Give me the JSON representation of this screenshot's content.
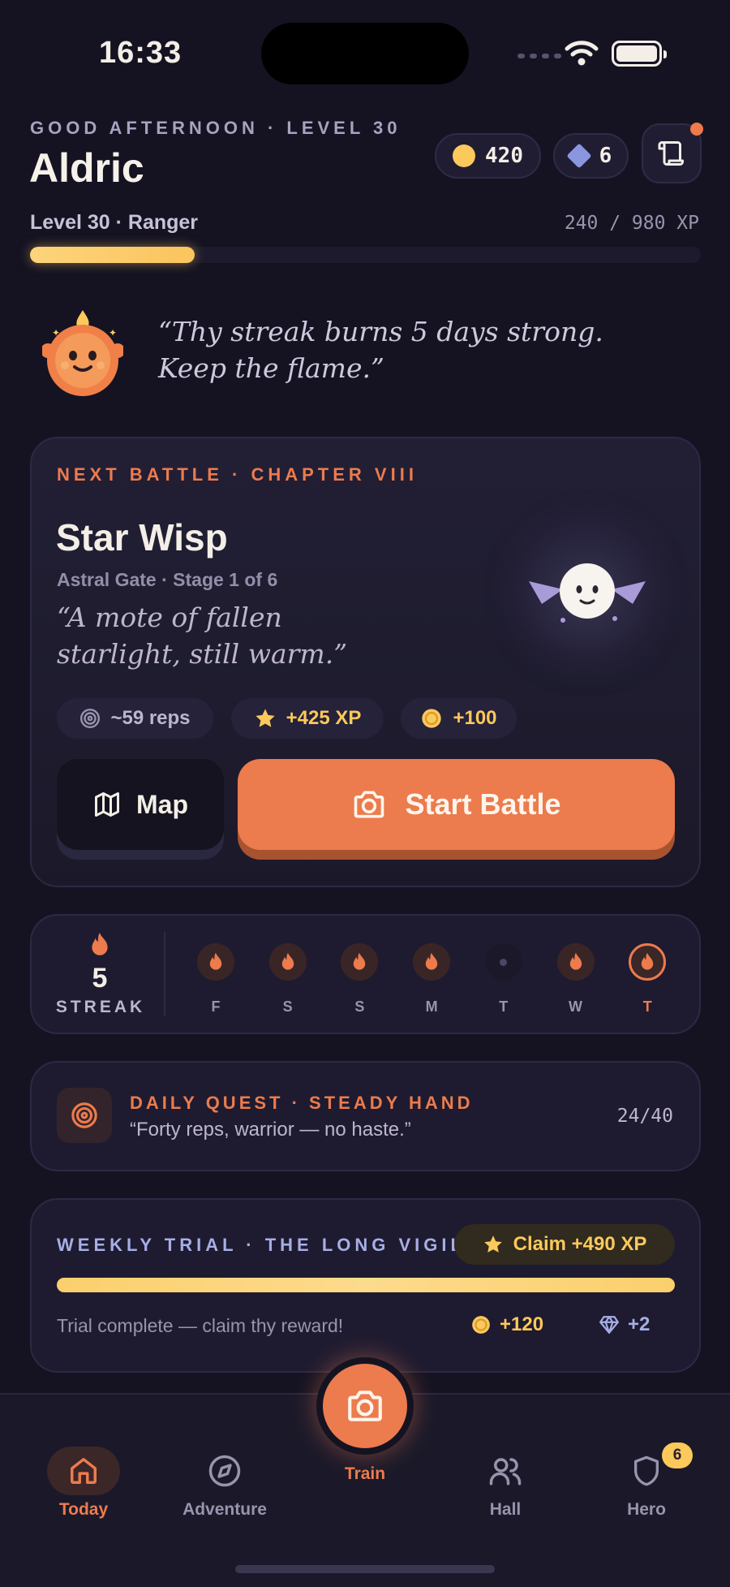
{
  "status_bar": {
    "time": "16:33"
  },
  "header": {
    "greeting": "GOOD AFTERNOON · LEVEL 30",
    "name": "Aldric",
    "coins": "420",
    "gems": "6",
    "level_label": "Level 30 · Ranger",
    "xp_label": "240 / 980 XP",
    "xp_fraction": 0.245
  },
  "mascot": {
    "quote": "“Thy streak burns 5 days strong. Keep the flame.”"
  },
  "battle": {
    "chapter": "NEXT BATTLE · CHAPTER VIII",
    "enemy_name": "Star Wisp",
    "stage": "Astral Gate · Stage 1 of 6",
    "flavor": "“A mote of fallen starlight, still warm.”",
    "reps": "~59 reps",
    "xp_reward": "+425 XP",
    "coin_reward": "+100",
    "map_label": "Map",
    "start_label": "Start Battle"
  },
  "streak": {
    "count": "5",
    "label": "STREAK",
    "days": [
      {
        "letter": "F",
        "state": "done"
      },
      {
        "letter": "S",
        "state": "done"
      },
      {
        "letter": "S",
        "state": "done"
      },
      {
        "letter": "M",
        "state": "done"
      },
      {
        "letter": "T",
        "state": "missed"
      },
      {
        "letter": "W",
        "state": "done"
      },
      {
        "letter": "T",
        "state": "today"
      }
    ]
  },
  "quest": {
    "title": "DAILY QUEST · STEADY HAND",
    "text": "“Forty reps, warrior — no haste.”",
    "progress": "24/40"
  },
  "weekly": {
    "title": "WEEKLY TRIAL · THE LONG VIGIL",
    "claim_label": "Claim +490 XP",
    "status": "Trial complete — claim thy reward!",
    "coin_reward": "+120",
    "gem_reward": "+2",
    "progress_fraction": 1.0
  },
  "nav": {
    "today": "Today",
    "adventure": "Adventure",
    "train": "Train",
    "hall": "Hall",
    "hero": "Hero",
    "hero_badge": "6"
  },
  "colors": {
    "accent": "#ec7b4d",
    "gold": "#fcc95a",
    "background": "#151322"
  }
}
